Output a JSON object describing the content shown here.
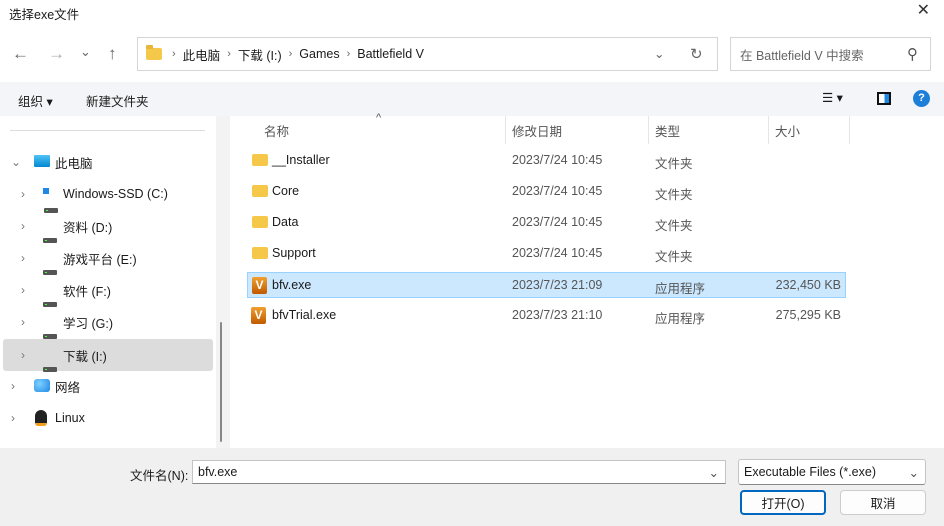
{
  "window": {
    "title": "选择exe文件",
    "close": "✕"
  },
  "nav": {
    "back": "←",
    "forward": "→",
    "recent": "⌄",
    "up": "↑"
  },
  "address": {
    "crumbs": [
      "此电脑",
      "下载 (I:)",
      "Games",
      "Battlefield V"
    ],
    "sep": "›",
    "dropdown": "⌄",
    "refresh": "↻"
  },
  "search": {
    "placeholder": "在 Battlefield V 中搜索",
    "icon": "⚲"
  },
  "toolbar": {
    "organize": "组织 ▾",
    "new_folder": "新建文件夹",
    "view": "☰ ▾",
    "help": "?"
  },
  "tree": [
    {
      "label": "此电脑",
      "chev": "⌄"
    },
    {
      "label": "Windows-SSD (C:)",
      "chev": "›"
    },
    {
      "label": "资料 (D:)",
      "chev": "›"
    },
    {
      "label": "游戏平台 (E:)",
      "chev": "›"
    },
    {
      "label": "软件 (F:)",
      "chev": "›"
    },
    {
      "label": "学习 (G:)",
      "chev": "›"
    },
    {
      "label": "下载 (I:)",
      "chev": "›"
    },
    {
      "label": "网络",
      "chev": "›"
    },
    {
      "label": "Linux",
      "chev": "›"
    }
  ],
  "columns": {
    "name": "名称",
    "date": "修改日期",
    "type": "类型",
    "size": "大小",
    "sort": "^"
  },
  "files": [
    {
      "name": "__Installer",
      "date": "2023/7/24 10:45",
      "type": "文件夹",
      "size": ""
    },
    {
      "name": "Core",
      "date": "2023/7/24 10:45",
      "type": "文件夹",
      "size": ""
    },
    {
      "name": "Data",
      "date": "2023/7/24 10:45",
      "type": "文件夹",
      "size": ""
    },
    {
      "name": "Support",
      "date": "2023/7/24 10:45",
      "type": "文件夹",
      "size": ""
    },
    {
      "name": "bfv.exe",
      "date": "2023/7/23 21:09",
      "type": "应用程序",
      "size": "232,450 KB",
      "icon": "V"
    },
    {
      "name": "bfvTrial.exe",
      "date": "2023/7/23 21:10",
      "type": "应用程序",
      "size": "275,295 KB",
      "icon": "V"
    }
  ],
  "footer": {
    "filename_label": "文件名(N):",
    "filename": "bfv.exe",
    "filter": "Executable Files (*.exe)",
    "open": "打开(O)",
    "cancel": "取消",
    "caret": "⌄"
  }
}
